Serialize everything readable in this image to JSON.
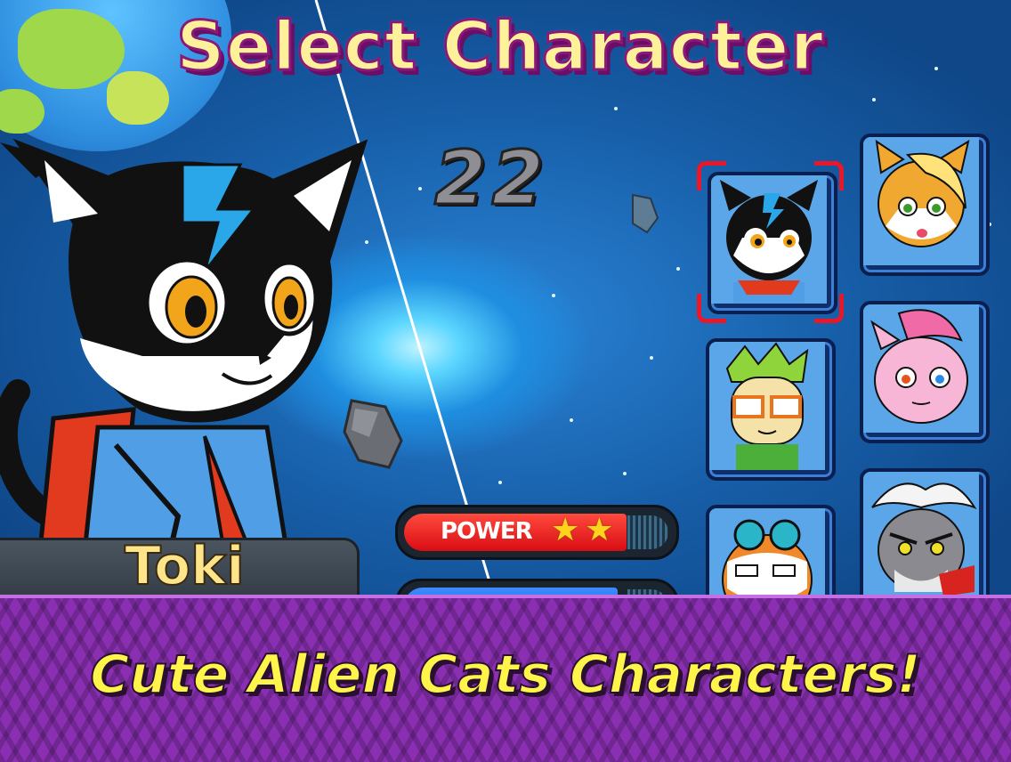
{
  "screen": {
    "title": "Select Character",
    "count": "22",
    "selected_character": {
      "name": "Toki",
      "power_label": "POWER",
      "power_stars": 2,
      "power_stars_text": "★★"
    },
    "roster": [
      {
        "id": "toki",
        "selected": true,
        "icon": "black-cat-icon"
      },
      {
        "id": "blonde-cat",
        "selected": false,
        "icon": "orange-cat-icon"
      },
      {
        "id": "green-hair-cat",
        "selected": false,
        "icon": "green-cat-icon"
      },
      {
        "id": "pink-cat",
        "selected": false,
        "icon": "pink-cat-icon"
      },
      {
        "id": "goggles-cat",
        "selected": false,
        "icon": "tabby-cat-icon"
      },
      {
        "id": "white-hair-cat",
        "selected": false,
        "icon": "gray-cat-icon"
      }
    ]
  },
  "banner": {
    "tagline": "Cute Alien Cats Characters!"
  },
  "colors": {
    "title_fill": "#fff19a",
    "title_outline": "#8a1a7a",
    "banner": "#8a2fb2",
    "power_bar": "#e8141e",
    "selection_bracket": "#e8182a"
  }
}
